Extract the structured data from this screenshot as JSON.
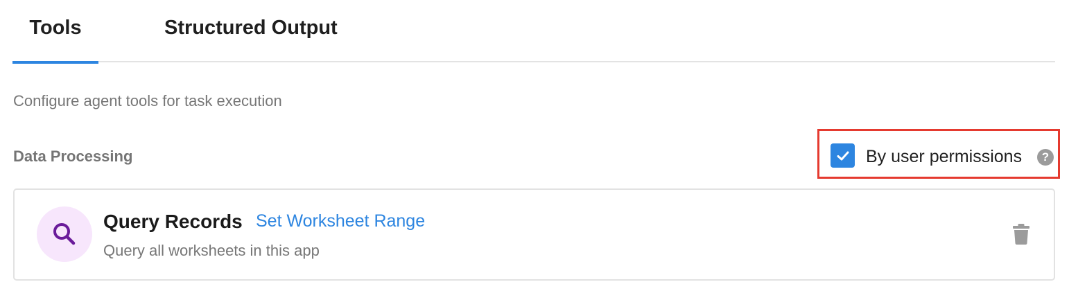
{
  "tabs": [
    {
      "label": "Tools",
      "active": true
    },
    {
      "label": "Structured Output",
      "active": false
    }
  ],
  "description": "Configure agent tools for task execution",
  "section": {
    "title": "Data Processing"
  },
  "permissions": {
    "label": "By user permissions",
    "checked": true,
    "help_icon": "question-mark-icon",
    "help_glyph": "?"
  },
  "tool": {
    "icon": "search-icon",
    "name": "Query Records",
    "link_label": "Set Worksheet Range",
    "description": "Query all worksheets in this app",
    "delete_icon": "trash-icon"
  },
  "colors": {
    "accent": "#2d85e0",
    "highlight_border": "#e53a2f",
    "icon_bg": "#f7e6fc",
    "icon_fg": "#6a1b9a",
    "muted_text": "#767676"
  }
}
